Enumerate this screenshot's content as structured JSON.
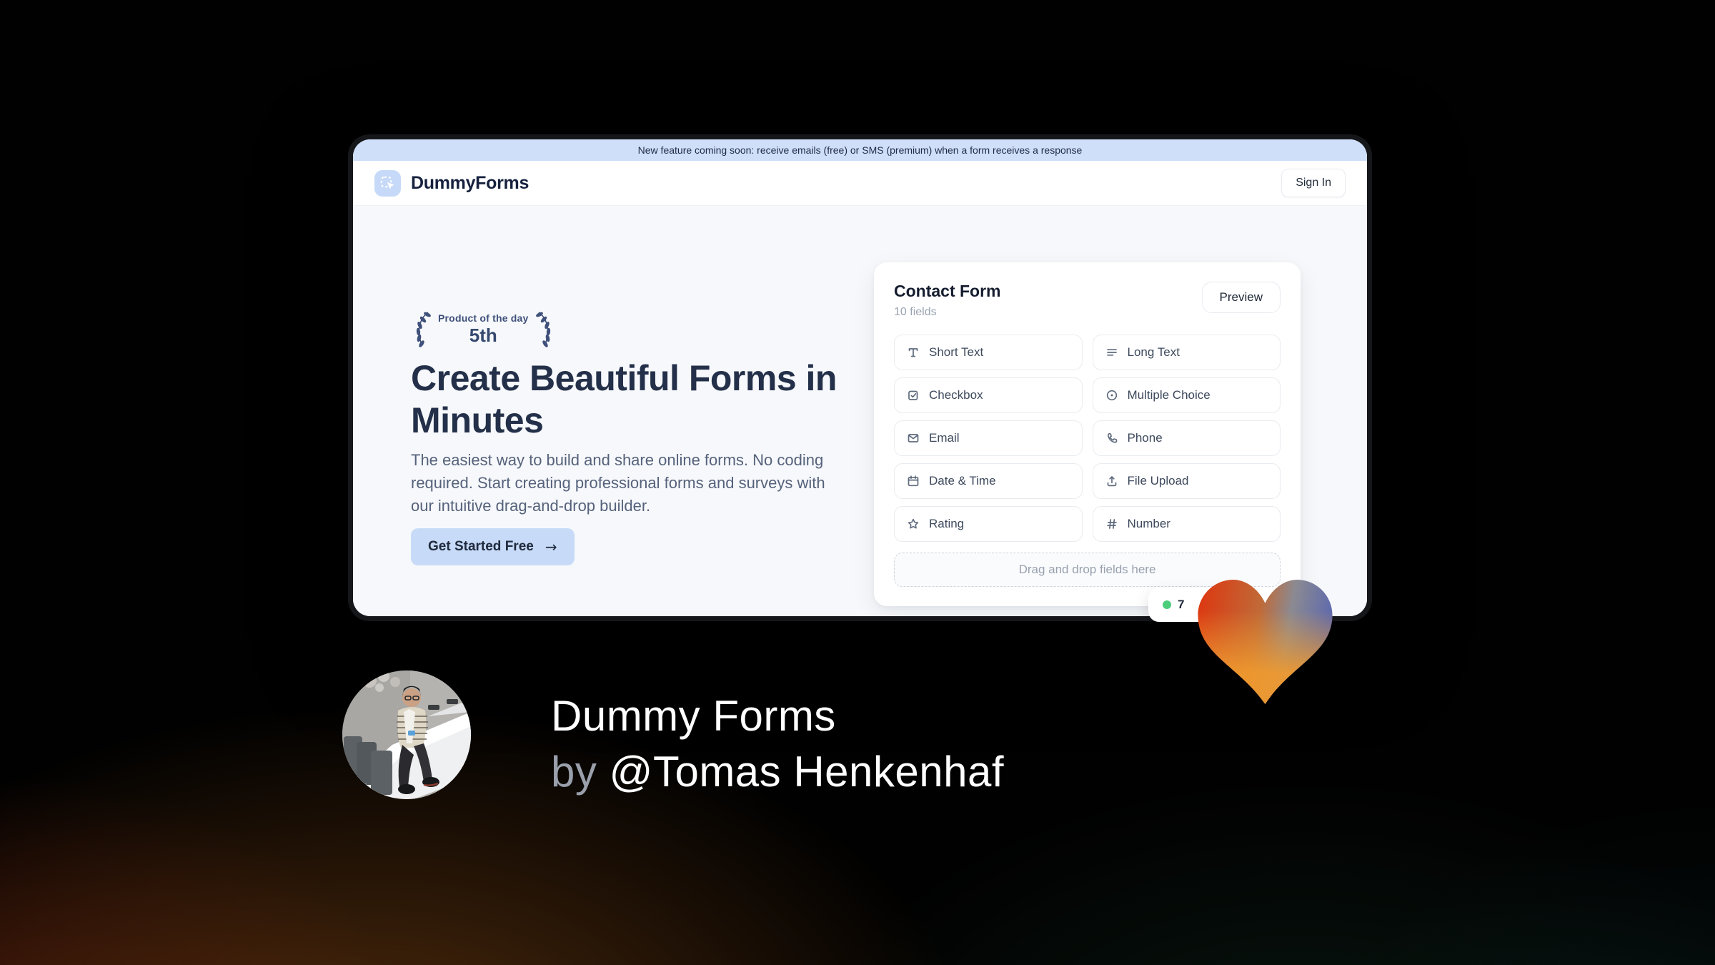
{
  "banner": {
    "text": "New feature coming soon: receive emails (free) or SMS (premium) when a form receives a response"
  },
  "header": {
    "brand": "DummyForms",
    "sign_in_label": "Sign In"
  },
  "hero": {
    "award": {
      "top": "Product of the day",
      "rank": "5th"
    },
    "headline": "Create Beautiful Forms in Minutes",
    "subtext": "The easiest way to build and share online forms. No coding required. Start creating professional forms and surveys with our intuitive drag-and-drop builder.",
    "cta_label": "Get Started Free",
    "cta_arrow": "→"
  },
  "form_builder": {
    "title": "Contact Form",
    "field_count_label": "10 fields",
    "preview_label": "Preview",
    "fields": [
      {
        "label": "Short Text",
        "icon": "short-text-icon"
      },
      {
        "label": "Long Text",
        "icon": "long-text-icon"
      },
      {
        "label": "Checkbox",
        "icon": "checkbox-icon"
      },
      {
        "label": "Multiple Choice",
        "icon": "radio-icon"
      },
      {
        "label": "Email",
        "icon": "email-icon"
      },
      {
        "label": "Phone",
        "icon": "phone-icon"
      },
      {
        "label": "Date & Time",
        "icon": "calendar-icon"
      },
      {
        "label": "File Upload",
        "icon": "upload-icon"
      },
      {
        "label": "Rating",
        "icon": "star-icon"
      },
      {
        "label": "Number",
        "icon": "hash-icon"
      }
    ],
    "dropzone_text": "Drag and drop fields here",
    "status_badge": {
      "value": "7",
      "dot_color": "#4ccd7c"
    }
  },
  "footer": {
    "title": "Dummy Forms",
    "byline_prefix": "by",
    "author": "@Tomas Henkenhaf"
  },
  "colors": {
    "banner_bg": "#cfdef9",
    "accent_blue": "#c7dbf8",
    "hero_bg": "#f6f8fb",
    "navy_text": "#243049",
    "heart_red": "#dc3912",
    "heart_orange": "#f09a2e",
    "heart_blue": "#5c68ae",
    "status_dot_green": "#4ccd7c"
  }
}
